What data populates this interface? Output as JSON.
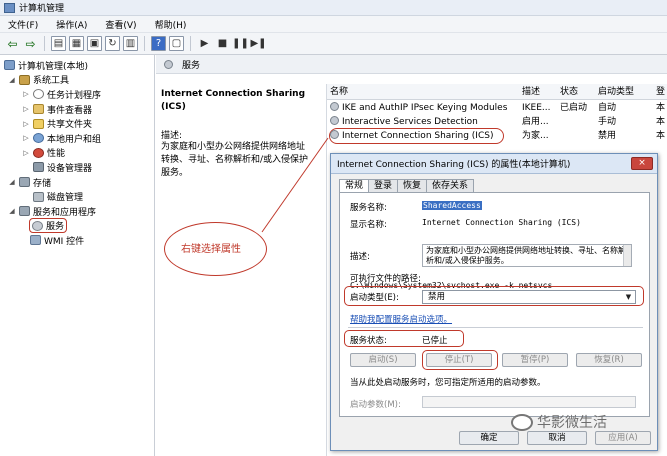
{
  "window": {
    "title": "计算机管理"
  },
  "menu": [
    {
      "label": "文件(F)"
    },
    {
      "label": "操作(A)"
    },
    {
      "label": "查看(V)"
    },
    {
      "label": "帮助(H)"
    }
  ],
  "toolbar": {
    "icons": [
      "back-icon",
      "forward-icon",
      "up-icon",
      "show-hide-tree-icon",
      "properties-icon",
      "refresh-icon",
      "export-icon",
      "help-icon",
      "view-icon",
      "start-icon",
      "stop-icon",
      "pause-icon",
      "restart-icon"
    ]
  },
  "tree": [
    {
      "label": "计算机管理(本地)",
      "level": 0,
      "expander": "",
      "icon": "computer-icon"
    },
    {
      "label": "系统工具",
      "level": 1,
      "expander": "◢",
      "icon": "tools-icon"
    },
    {
      "label": "任务计划程序",
      "level": 2,
      "expander": "▷",
      "icon": "clock-icon"
    },
    {
      "label": "事件查看器",
      "level": 2,
      "expander": "▷",
      "icon": "event-log-icon"
    },
    {
      "label": "共享文件夹",
      "level": 2,
      "expander": "▷",
      "icon": "folder-icon"
    },
    {
      "label": "本地用户和组",
      "level": 2,
      "expander": "▷",
      "icon": "users-icon"
    },
    {
      "label": "性能",
      "level": 2,
      "expander": "▷",
      "icon": "performance-icon"
    },
    {
      "label": "设备管理器",
      "level": 2,
      "expander": "",
      "icon": "device-icon"
    },
    {
      "label": "存储",
      "level": 1,
      "expander": "◢",
      "icon": "storage-icon"
    },
    {
      "label": "磁盘管理",
      "level": 2,
      "expander": "",
      "icon": "disk-icon"
    },
    {
      "label": "服务和应用程序",
      "level": 1,
      "expander": "◢",
      "icon": "services-apps-icon"
    },
    {
      "label": "服务",
      "level": 2,
      "expander": "",
      "icon": "gear-icon"
    },
    {
      "label": "WMI 控件",
      "level": 2,
      "expander": "",
      "icon": "wmi-icon"
    }
  ],
  "middle": {
    "header": "服务",
    "service_title": "Internet Connection Sharing (ICS)",
    "description_label": "描述:",
    "description": "为家庭和小型办公网络提供网络地址转换、寻址、名称解析和/或入侵保护服务。"
  },
  "services": {
    "columns": [
      "名称",
      "描述",
      "状态",
      "启动类型",
      "登"
    ],
    "rows": [
      {
        "name": "IKE and AuthIP IPsec Keying Modules",
        "desc": "IKEE...",
        "status": "已启动",
        "startup": "自动",
        "logon": "本"
      },
      {
        "name": "Interactive Services Detection",
        "desc": "启用...",
        "status": "",
        "startup": "手动",
        "logon": "本"
      },
      {
        "name": "Internet Connection Sharing (ICS)",
        "desc": "为家...",
        "status": "",
        "startup": "禁用",
        "logon": "本"
      }
    ]
  },
  "dialog": {
    "title": "Internet Connection Sharing (ICS) 的属性(本地计算机)",
    "close": "×",
    "tabs": [
      "常规",
      "登录",
      "恢复",
      "依存关系"
    ],
    "service_name_label": "服务名称:",
    "service_name": "SharedAccess",
    "display_name_label": "显示名称:",
    "display_name": "Internet Connection Sharing (ICS)",
    "description_label": "描述:",
    "description": "为家庭和小型办公网络提供网络地址转换、寻址、名称解析和/或入侵保护服务。",
    "exe_path_label": "可执行文件的路径:",
    "exe_path": "C:\\Windows\\System32\\svchost.exe -k netsvcs",
    "startup_type_label": "启动类型(E):",
    "startup_type": "禁用",
    "help_link": "帮助我配置服务启动选项。",
    "status_label": "服务状态:",
    "status": "已停止",
    "buttons": {
      "start": "启动(S)",
      "stop": "停止(T)",
      "pause": "暂停(P)",
      "resume": "恢复(R)"
    },
    "hint": "当从此处启动服务时，您可指定所适用的启动参数。",
    "params_label": "启动参数(M):",
    "ok": "确定",
    "cancel": "取消",
    "apply": "应用(A)"
  },
  "annotation": {
    "text": "右键选择属性",
    "color": "#c0392b"
  },
  "watermark": {
    "text": "华影微生活"
  }
}
